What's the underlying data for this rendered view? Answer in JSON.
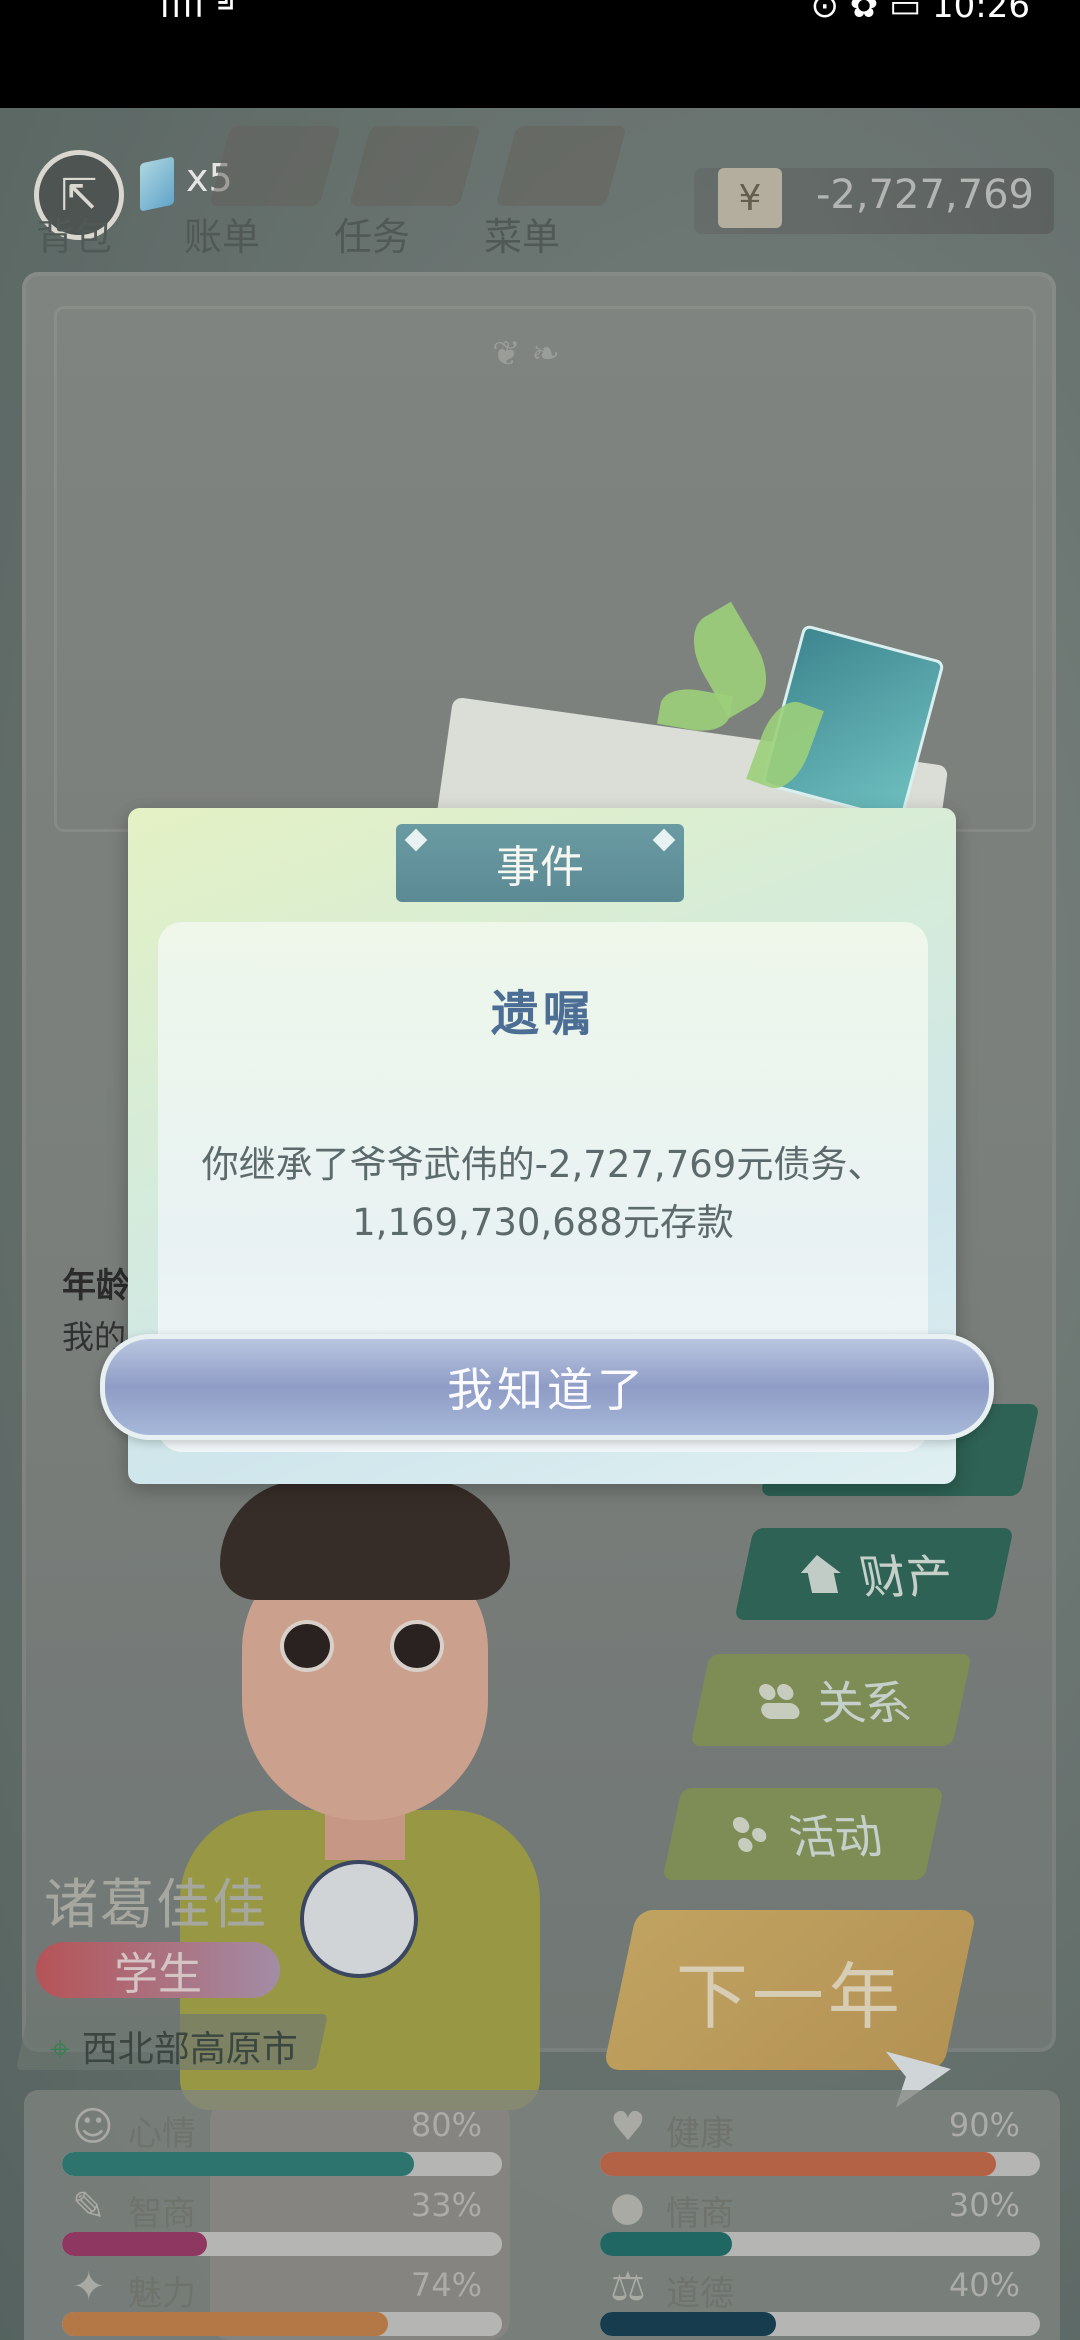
{
  "status_bar": {
    "left_icons": "ııll ╝",
    "right_icons": "⊙ ✿ ▭ 10:26"
  },
  "top_nav": {
    "gem_count": "x5",
    "items": [
      {
        "label": "背包"
      },
      {
        "label": "账单"
      },
      {
        "label": "任务"
      },
      {
        "label": "菜单"
      }
    ],
    "currency_symbol": "¥",
    "money": "-2,727,769"
  },
  "background_text": {
    "age_label": "年龄",
    "my_label": "我的"
  },
  "dialog": {
    "header": "事件",
    "title": "遗嘱",
    "body": "你继承了爷爷武伟的-2,727,769元债务、1,169,730,688元存款",
    "confirm": "我知道了"
  },
  "side_menu": [
    {
      "label": "财产",
      "icon": "house-icon"
    },
    {
      "label": "关系",
      "icon": "people-icon"
    },
    {
      "label": "活动",
      "icon": "dots-icon"
    }
  ],
  "next_year": "下一年",
  "character": {
    "name": "诸葛佳佳",
    "role": "学生",
    "location": "西北部高原市"
  },
  "stats": [
    {
      "label": "心情",
      "value": "80%",
      "level": 0.8,
      "color": "#2d7f77",
      "icon": "smile-icon"
    },
    {
      "label": "健康",
      "value": "90%",
      "level": 0.9,
      "color": "#c76a49",
      "icon": "heart-icon"
    },
    {
      "label": "智商",
      "value": "33%",
      "level": 0.33,
      "color": "#9b3a69",
      "icon": "bulb-icon"
    },
    {
      "label": "情商",
      "value": "30%",
      "level": 0.3,
      "color": "#1f6f6a",
      "icon": "apple-icon"
    },
    {
      "label": "魅力",
      "value": "74%",
      "level": 0.74,
      "color": "#c8824a",
      "icon": "star-icon"
    },
    {
      "label": "道德",
      "value": "40%",
      "level": 0.4,
      "color": "#143f52",
      "icon": "scale-icon"
    }
  ]
}
